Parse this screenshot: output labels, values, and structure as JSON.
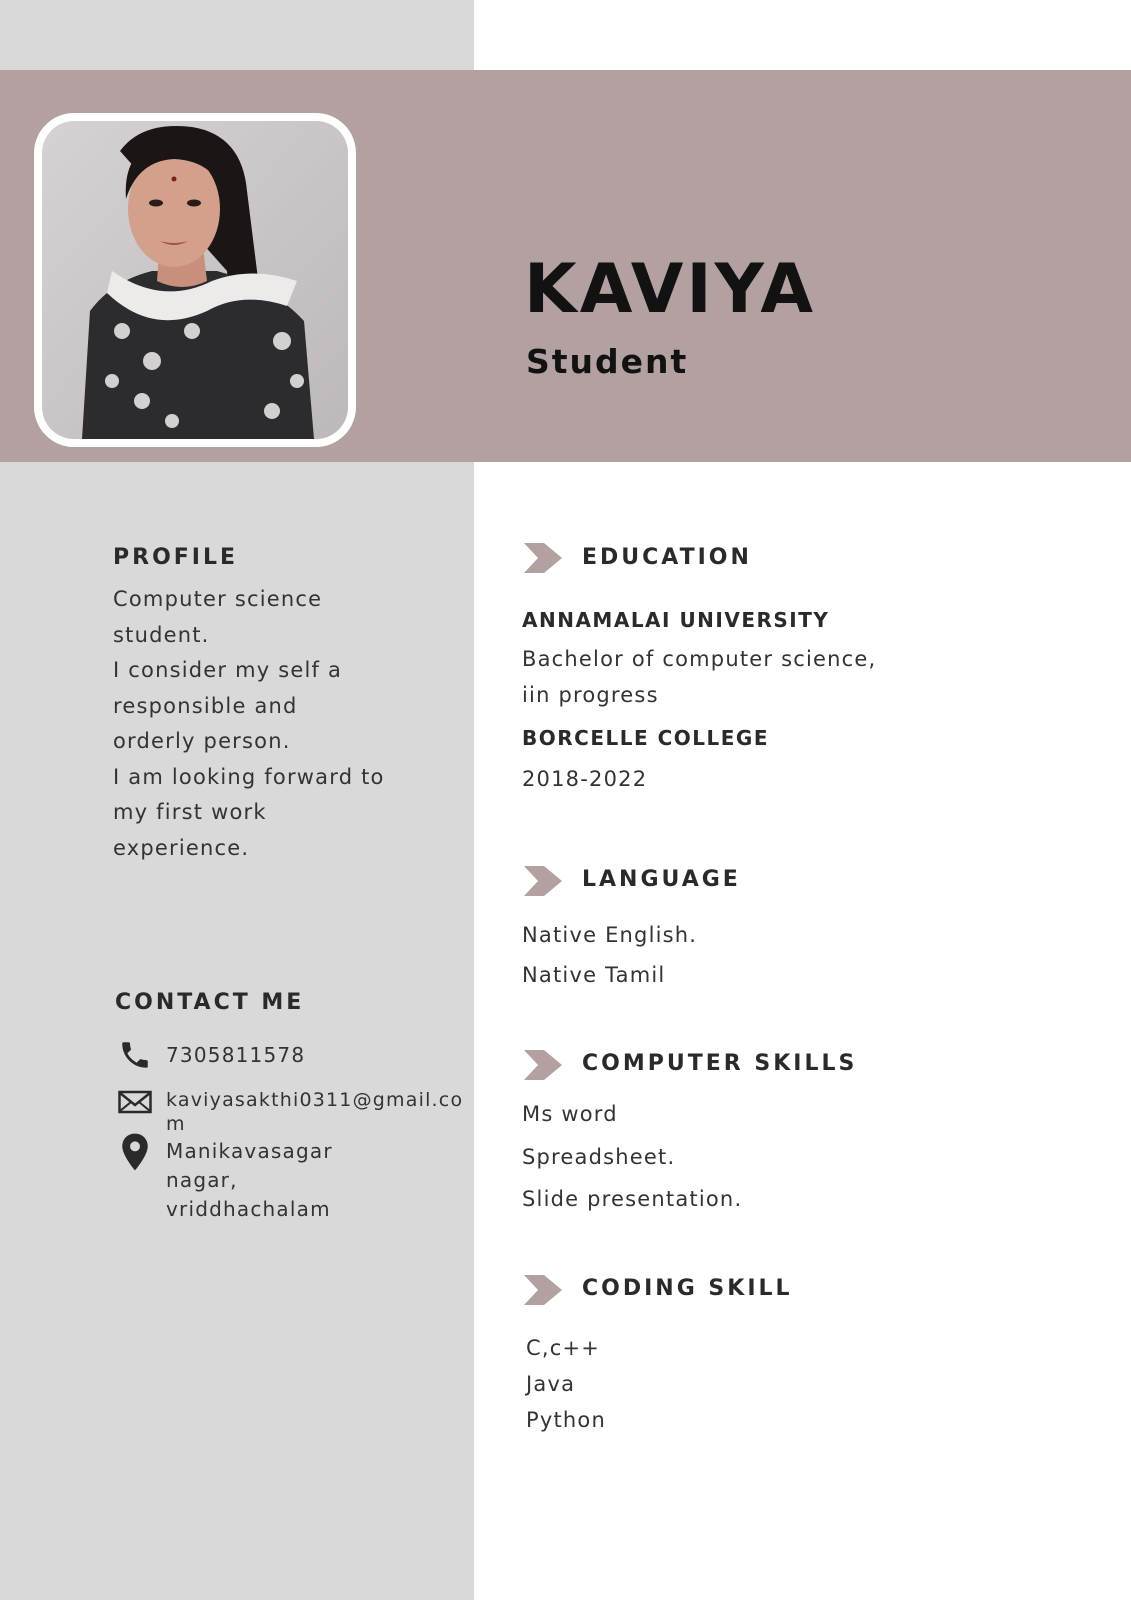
{
  "header": {
    "name": "KAVIYA",
    "role": "Student"
  },
  "profile": {
    "heading": "PROFILE",
    "lines": [
      "Computer science",
      "student.",
      "I consider my self a",
      "responsible and",
      "orderly person.",
      "I am looking forward to",
      "my first work",
      "experience."
    ]
  },
  "contact": {
    "heading": "CONTACT ME",
    "phone": "7305811578",
    "email_line1": "kaviyasakthi0311@gmail.co",
    "email_line2": "m",
    "address_lines": [
      "Manikavasagar",
      "nagar,",
      "vriddhachalam"
    ]
  },
  "education": {
    "heading": "EDUCATION",
    "school1": "ANNAMALAI UNIVERSITY",
    "degree_line1": "Bachelor of computer science,",
    "degree_line2": "iin progress",
    "school2": "BORCELLE COLLEGE",
    "years": "2018-2022"
  },
  "language": {
    "heading": "LANGUAGE",
    "items": [
      "Native English.",
      "Native Tamil"
    ]
  },
  "computer_skills": {
    "heading": "COMPUTER SKILLS",
    "items": [
      "Ms word",
      "Spreadsheet.",
      "Slide presentation."
    ]
  },
  "coding_skill": {
    "heading": "CODING SKILL",
    "items": [
      "C,c++",
      "Java",
      "Python"
    ]
  },
  "colors": {
    "accent": "#b3a0a1",
    "sidebar": "#d9d9da",
    "text": "#2b2b2b"
  }
}
